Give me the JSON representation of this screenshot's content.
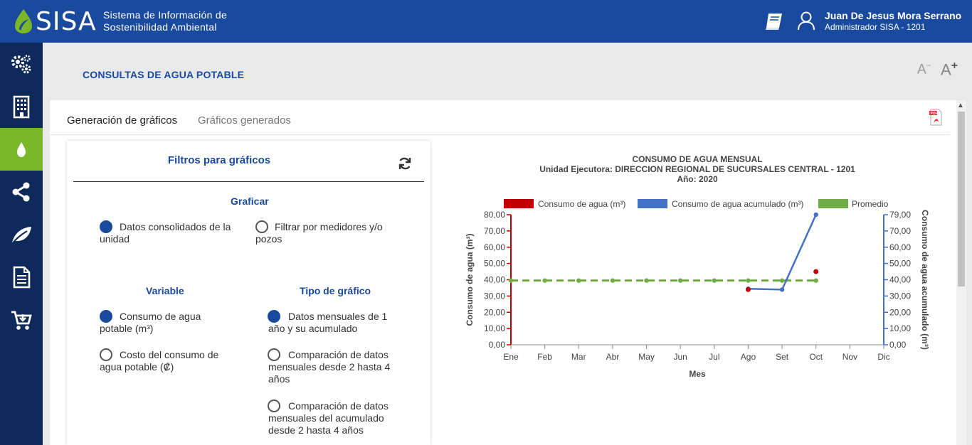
{
  "header": {
    "logo_text": "SISA",
    "subtitle_line1": "Sistema de Información de",
    "subtitle_line2": "Sostenibilidad Ambiental",
    "user_name": "Juan De Jesus Mora Serrano",
    "user_role": "Administrador SISA - 1201",
    "colors": {
      "bar": "#1a4a9e",
      "sidebar": "#0e2a5a",
      "accent": "#7ab829"
    }
  },
  "sidebar": {
    "items": [
      {
        "icon": "gears-icon"
      },
      {
        "icon": "building-icon"
      },
      {
        "icon": "water-drop-icon",
        "active": true
      },
      {
        "icon": "share-icon"
      },
      {
        "icon": "leaf-icon"
      },
      {
        "icon": "document-icon"
      },
      {
        "icon": "cart-icon"
      }
    ]
  },
  "page": {
    "title": "CONSULTAS DE AGUA POTABLE",
    "font_decrease": "A",
    "font_increase": "A"
  },
  "tabs": [
    {
      "label": "Generación de gráficos",
      "active": true
    },
    {
      "label": "Gráficos generados",
      "active": false
    }
  ],
  "filters": {
    "title": "Filtros para gráficos",
    "graficar": {
      "heading": "Graficar",
      "options": [
        {
          "line1": "Datos consolidados de la",
          "line2": "unidad",
          "selected": true
        },
        {
          "line1": "Filtrar por medidores y/o",
          "line2": "pozos",
          "selected": false
        }
      ]
    },
    "variable": {
      "heading": "Variable",
      "options": [
        {
          "line1": "Consumo de agua",
          "line2": "potable (m³)",
          "selected": true
        },
        {
          "line1": "Costo del consumo de",
          "line2": "agua potable (₡)",
          "selected": false
        }
      ]
    },
    "tipo": {
      "heading": "Tipo de gráfico",
      "options": [
        {
          "line1": "Datos mensuales de 1",
          "line2": "año y su acumulado",
          "line3": "",
          "selected": true
        },
        {
          "line1": "Comparación de datos",
          "line2": "mensuales desde 2 hasta 4",
          "line3": "años",
          "selected": false
        },
        {
          "line1": "Comparación de datos",
          "line2": "mensuales del acumulado",
          "line3": "desde 2 hasta 4 años",
          "selected": false
        }
      ]
    }
  },
  "chart_data": {
    "type": "line",
    "title": "CONSUMO DE AGUA MENSUAL",
    "subtitle": "Unidad Ejecutora: DIRECCION REGIONAL DE SUCURSALES CENTRAL - 1201",
    "subtitle2": "Año: 2020",
    "xlabel": "Mes",
    "ylabel": "Consumo de agua  (m³)",
    "ylabel_right": "Consumo de agua acumulado  (m³)",
    "categories": [
      "Ene",
      "Feb",
      "Mar",
      "Abr",
      "May",
      "Jun",
      "Jul",
      "Ago",
      "Set",
      "Oct",
      "Nov",
      "Dic"
    ],
    "ylim": [
      0,
      80
    ],
    "yticks": [
      "0,00",
      "10,00",
      "20,00",
      "30,00",
      "40,00",
      "50,00",
      "60,00",
      "70,00",
      "80,00"
    ],
    "ylim_right": [
      0,
      79
    ],
    "yticks_right": [
      "0,00",
      "10,00",
      "20,00",
      "30,00",
      "40,00",
      "50,00",
      "60,00",
      "70,00",
      "79,00"
    ],
    "legend_position": "top",
    "series": [
      {
        "name": "Consumo de agua  (m³)",
        "color": "#c00000",
        "values": [
          null,
          null,
          null,
          null,
          null,
          null,
          null,
          34,
          null,
          45,
          null,
          null
        ]
      },
      {
        "name": "Consumo de agua acumulado  (m³)",
        "color": "#4472c4",
        "values": [
          null,
          null,
          null,
          null,
          null,
          null,
          null,
          34,
          33.5,
          79,
          null,
          null
        ]
      },
      {
        "name": "Promedio",
        "color": "#70ad47",
        "values": [
          39.5,
          39.5,
          39.5,
          39.5,
          39.5,
          39.5,
          39.5,
          39.5,
          39.5,
          39.5,
          null,
          null
        ]
      }
    ]
  }
}
